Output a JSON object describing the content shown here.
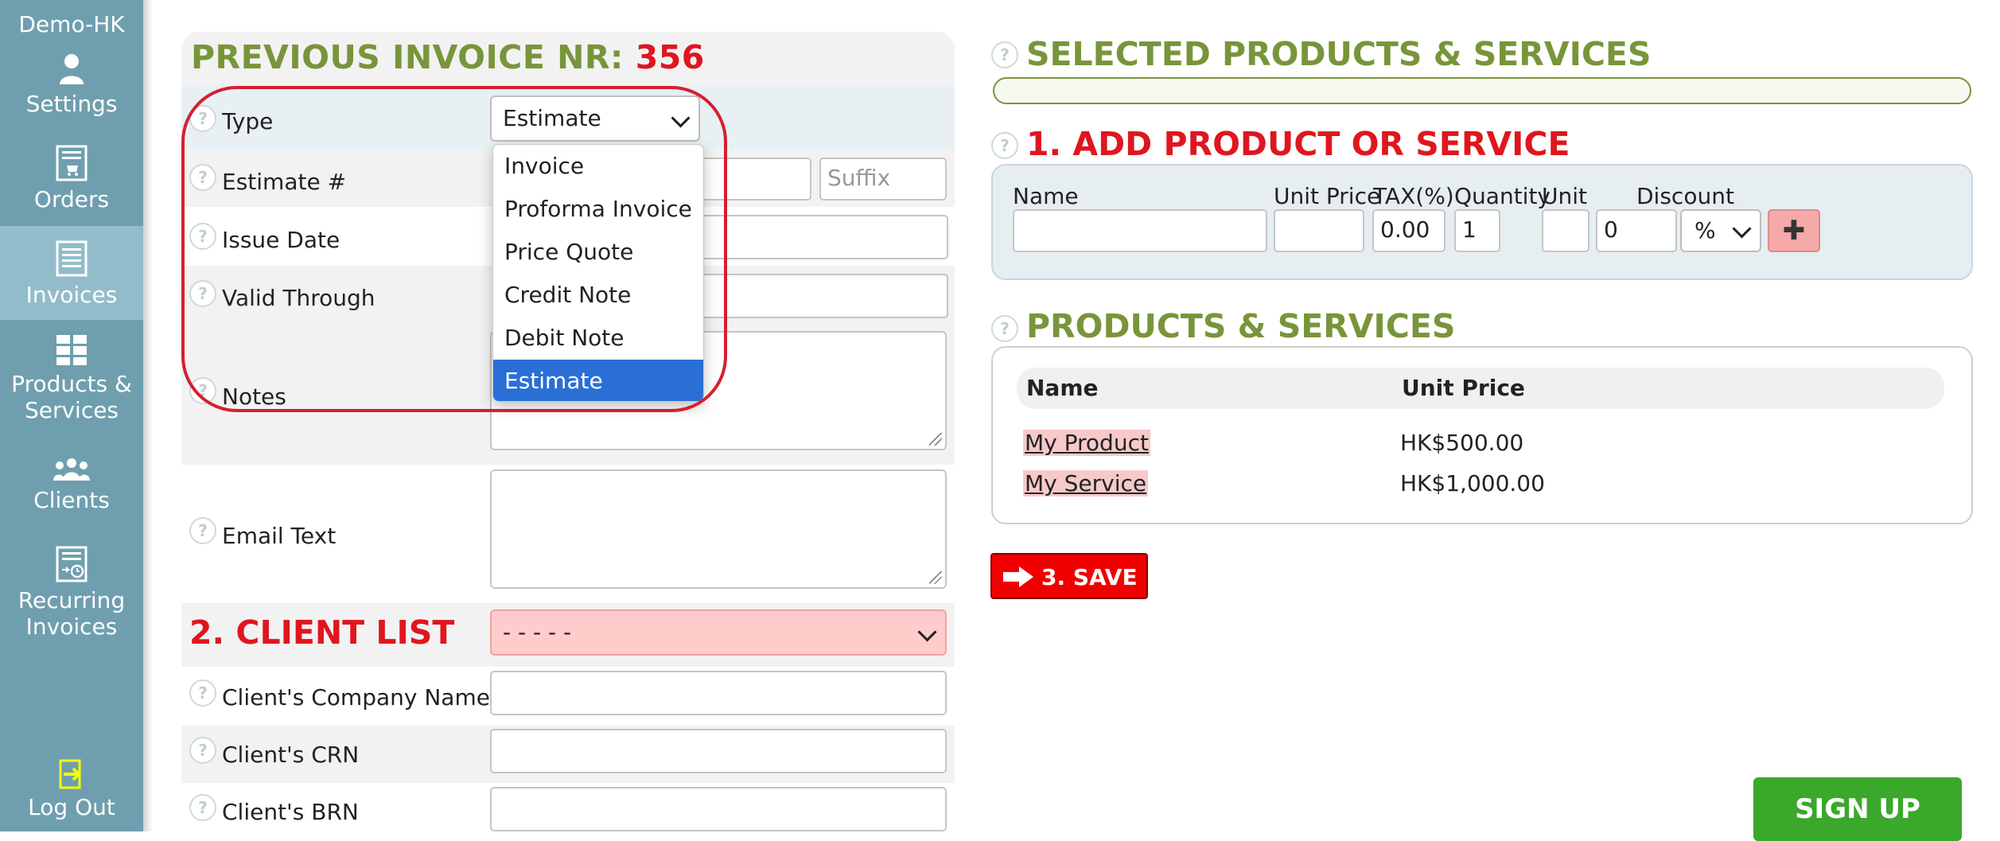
{
  "sidebar": {
    "brand": "Demo-HK",
    "items": [
      {
        "label": "Settings",
        "icon": "user-icon"
      },
      {
        "label": "Orders",
        "icon": "orders-icon"
      },
      {
        "label": "Invoices",
        "icon": "invoice-icon",
        "active": true
      },
      {
        "label_line1": "Products &",
        "label_line2": "Services",
        "icon": "grid-icon"
      },
      {
        "label": "Clients",
        "icon": "clients-icon"
      },
      {
        "label_line1": "Recurring",
        "label_line2": "Invoices",
        "icon": "recurring-icon"
      },
      {
        "label": "Log Out",
        "icon": "logout-icon"
      }
    ]
  },
  "form": {
    "title_prefix": "PREVIOUS INVOICE NR:",
    "title_number": "356",
    "type_label": "Type",
    "type_value": "Estimate",
    "type_options": [
      "Invoice",
      "Proforma Invoice",
      "Price Quote",
      "Credit Note",
      "Debit Note",
      "Estimate"
    ],
    "estimate_label": "Estimate #",
    "suffix_placeholder": "Suffix",
    "issue_date_label": "Issue Date",
    "valid_through_label": "Valid Through",
    "notes_label": "Notes",
    "email_text_label": "Email Text",
    "client_list_title": "2. CLIENT LIST",
    "client_select_value": "- - - - -",
    "client_company_label": "Client's Company Name",
    "client_crn_label": "Client's CRN",
    "client_brn_label": "Client's BRN"
  },
  "selected": {
    "title": "SELECTED PRODUCTS & SERVICES"
  },
  "add_product": {
    "title": "1. ADD PRODUCT OR SERVICE",
    "col_name": "Name",
    "col_unit_price": "Unit Price",
    "col_tax": "TAX(%)",
    "col_quantity": "Quantity",
    "col_unit": "Unit",
    "col_discount": "Discount",
    "tax_value": "0.00",
    "quantity_value": "1",
    "discount_value": "0",
    "discount_type": "%",
    "add_symbol": "✚"
  },
  "products": {
    "title": "PRODUCTS & SERVICES",
    "headers": [
      "Name",
      "Unit Price"
    ],
    "rows": [
      {
        "name": "My Product",
        "price": "HK$500.00"
      },
      {
        "name": "My Service",
        "price": "HK$1,000.00"
      }
    ]
  },
  "save_label": "3. SAVE",
  "signup_label": "SIGN UP",
  "colors": {
    "sidebar": "#6f9fae",
    "green": "#78953a",
    "red": "#e0161e",
    "selected_option": "#2a6fd6"
  }
}
